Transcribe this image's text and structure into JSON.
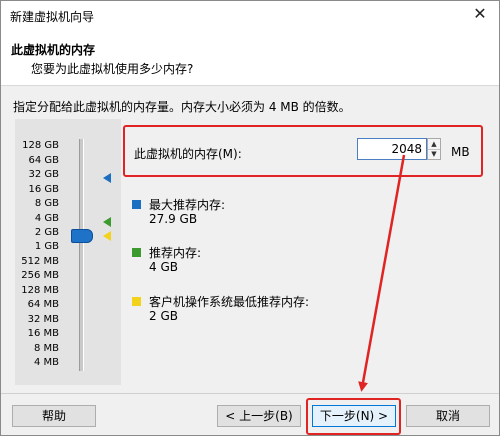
{
  "window": {
    "title": "新建虚拟机向导",
    "close_glyph": "✕"
  },
  "header": {
    "title": "此虚拟机的内存",
    "subtitle": "您要为此虚拟机使用多少内存?"
  },
  "instruction": "指定分配给此虚拟机的内存量。内存大小必须为 4 MB 的倍数。",
  "memory": {
    "label": "此虚拟机的内存(M):",
    "value": "2048",
    "unit": "MB",
    "spin_up": "▲",
    "spin_down": "▼"
  },
  "slider": {
    "labels": [
      "128 GB",
      "64 GB",
      "32 GB",
      "16 GB",
      "8 GB",
      "4 GB",
      "2 GB",
      "1 GB",
      "512 MB",
      "256 MB",
      "128 MB",
      "64 MB",
      "32 MB",
      "16 MB",
      "8 MB",
      "4 MB"
    ],
    "selected": "2 GB"
  },
  "legend": [
    {
      "label": "最大推荐内存:",
      "value": "27.9 GB",
      "color": "#1c6ec0"
    },
    {
      "label": "推荐内存:",
      "value": "4 GB",
      "color": "#3c9a2e"
    },
    {
      "label": "客户机操作系统最低推荐内存:",
      "value": "2 GB",
      "color": "#f2d21b"
    }
  ],
  "buttons": {
    "help": "帮助",
    "back": "< 上一步(B)",
    "next": "下一步(N) >",
    "cancel": "取消"
  },
  "colors": {
    "annotation_red": "#e02424",
    "thumb_blue": "#1e73c8"
  }
}
